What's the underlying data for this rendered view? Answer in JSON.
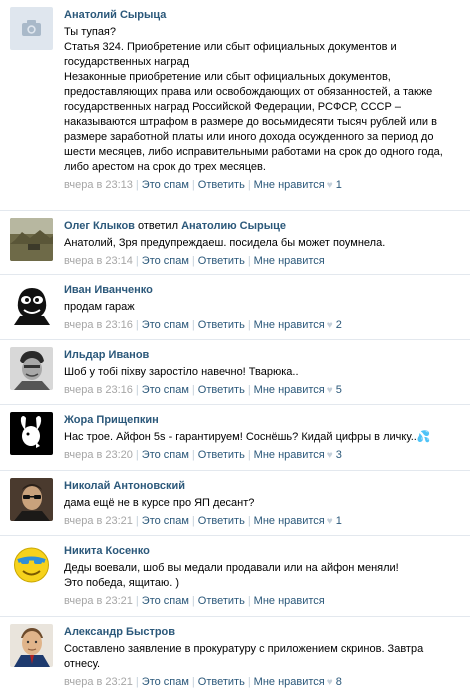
{
  "comments": [
    {
      "author": "Анатолий Сырыца",
      "reply_word": "",
      "reply_to": "",
      "text": "Ты тупая?\nСтатья 324. Приобретение или сбыт официальных документов и государственных наград\nНезаконные приобретение или сбыт официальных документов, предоставляющих права или освобождающих от обязанностей, а также государственных наград Российской Федерации, РСФСР, СССР – наказываются штрафом в размере до восьмидесяти тысяч рублей или в размере заработной платы или иного дохода осужденного за период до шести месяцев, либо исправительными работами на срок до одного года, либо арестом на срок до трех месяцев.",
      "time": "вчера в 23:13",
      "spam": "Это спам",
      "reply": "Ответить",
      "like": "Мне нравится",
      "likes": "1",
      "avatar": "camera-placeholder-icon"
    },
    {
      "author": "Олег Клыков",
      "reply_word": " ответил ",
      "reply_to": "Анатолию Сырыце",
      "text": "Анатолий, Зря предупреждаеш. посидела бы может поумнела.",
      "time": "вчера в 23:14",
      "spam": "Это спам",
      "reply": "Ответить",
      "like": "Мне нравится",
      "likes": "",
      "avatar": "landscape-photo"
    },
    {
      "author": "Иван Иванченко",
      "reply_word": "",
      "reply_to": "",
      "text": "продам гараж",
      "time": "вчера в 23:16",
      "spam": "Это спам",
      "reply": "Ответить",
      "like": "Мне нравится",
      "likes": "2",
      "avatar": "bw-cartoon-face"
    },
    {
      "author": "Ильдар Иванов",
      "reply_word": "",
      "reply_to": "",
      "text": "Шоб у тобі піхву заростіло навечно! Тварюка..",
      "time": "вчера в 23:16",
      "spam": "Это спам",
      "reply": "Ответить",
      "like": "Мне нравится",
      "likes": "5",
      "avatar": "bw-portrait"
    },
    {
      "author": "Жора Прищепкин",
      "reply_word": "",
      "reply_to": "",
      "text": "Нас трое. Айфон 5s - гарантируем! Соснёшь? Кидай цифры в личку..",
      "emoji": "💦",
      "time": "вчера в 23:20",
      "spam": "Это спам",
      "reply": "Ответить",
      "like": "Мне нравится",
      "likes": "3",
      "avatar": "bunny-logo"
    },
    {
      "author": "Николай Антоновский",
      "reply_word": "",
      "reply_to": "",
      "text": "дама ещё не в курсе про ЯП десант?",
      "time": "вчера в 23:21",
      "spam": "Это спам",
      "reply": "Ответить",
      "like": "Мне нравится",
      "likes": "1",
      "avatar": "sunglasses-portrait"
    },
    {
      "author": "Никита Косенко",
      "reply_word": "",
      "reply_to": "",
      "text": "Деды воевали, шоб вы медали продавали или на айфон меняли!\nЭто победа, ящитаю. )",
      "time": "вчера в 23:21",
      "spam": "Это спам",
      "reply": "Ответить",
      "like": "Мне нравится",
      "likes": "",
      "avatar": "smiley-face"
    },
    {
      "author": "Александр Быстров",
      "reply_word": "",
      "reply_to": "",
      "text": "Составлено заявление в прокуратуру с приложением скринов. Завтра отнесу.",
      "time": "вчера в 23:21",
      "spam": "Это спам",
      "reply": "Ответить",
      "like": "Мне нравится",
      "likes": "8",
      "avatar": "man-portrait"
    }
  ]
}
